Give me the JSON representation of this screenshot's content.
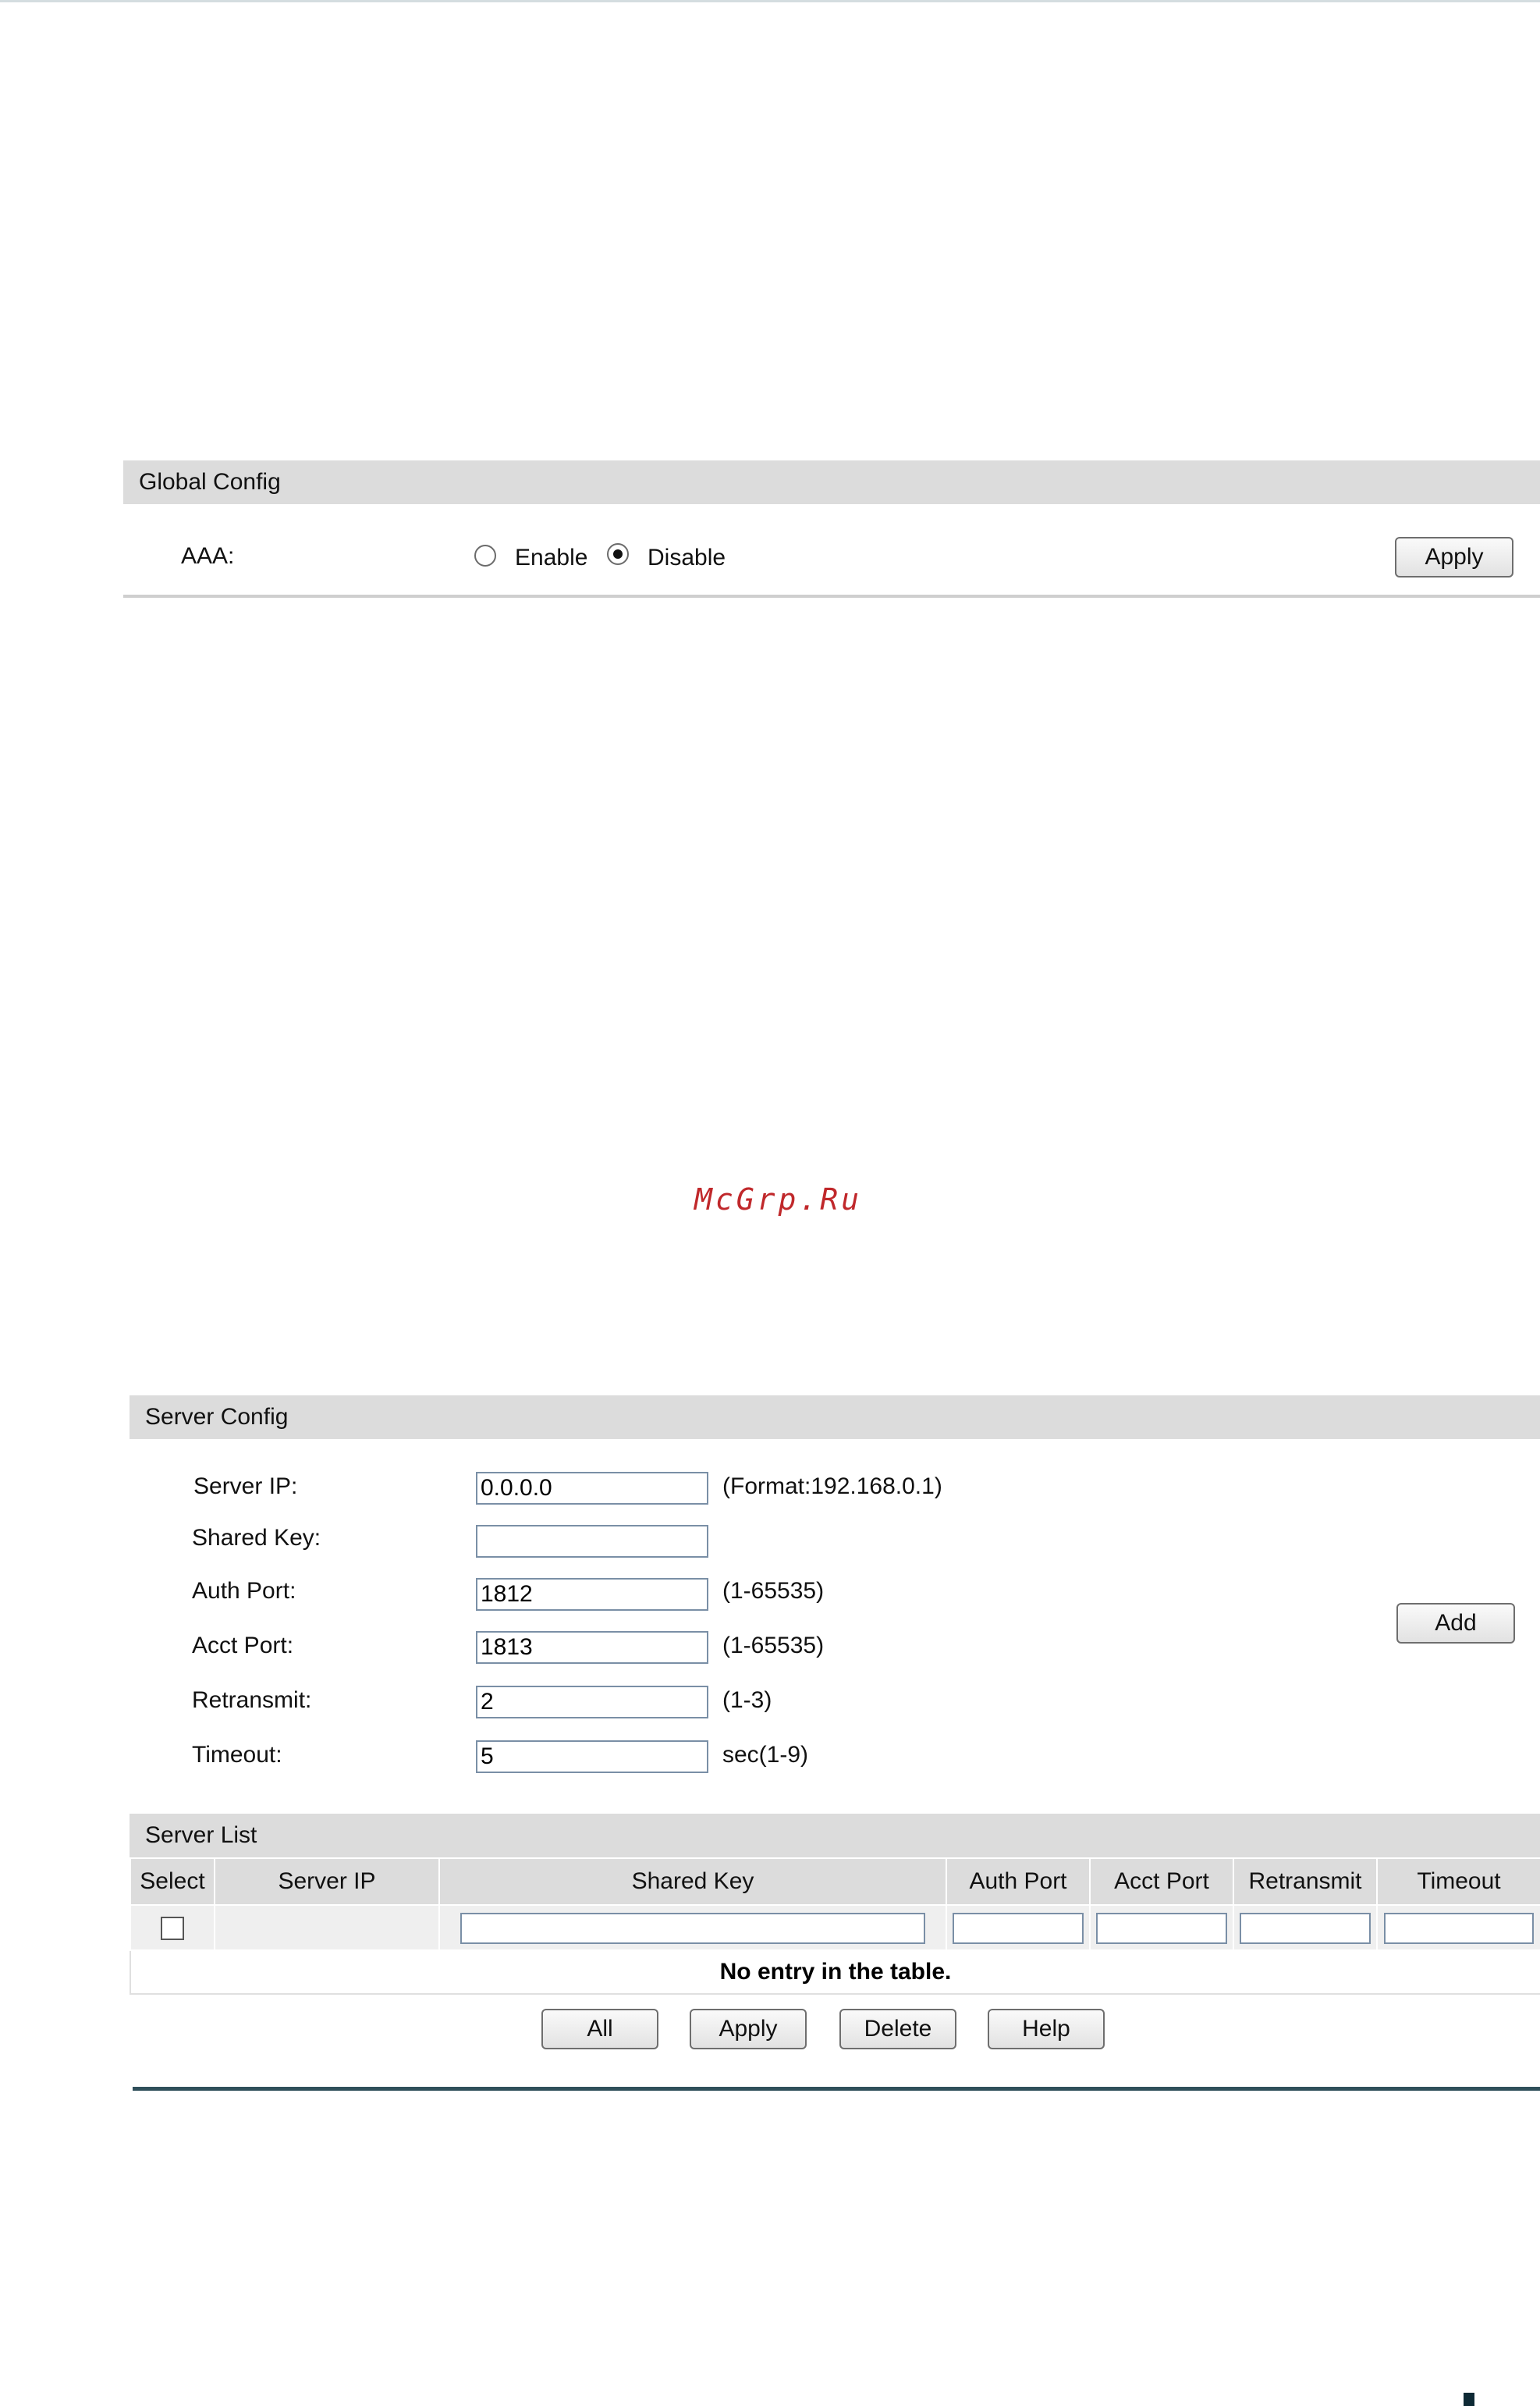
{
  "watermark": "McGrp.Ru",
  "global_config": {
    "title": "Global Config",
    "aaa_label": "AAA:",
    "options": [
      {
        "label": "Enable",
        "selected": false
      },
      {
        "label": "Disable",
        "selected": true
      }
    ],
    "apply_label": "Apply"
  },
  "server_config": {
    "title": "Server Config",
    "server_ip": {
      "label": "Server IP:",
      "value": "0.0.0.0",
      "hint": "(Format:192.168.0.1)"
    },
    "shared_key": {
      "label": "Shared Key:",
      "value": ""
    },
    "auth_port": {
      "label": "Auth Port:",
      "value": "1812",
      "hint": "(1-65535)"
    },
    "acct_port": {
      "label": "Acct Port:",
      "value": "1813",
      "hint": "(1-65535)"
    },
    "retransmit": {
      "label": "Retransmit:",
      "value": "2",
      "hint": "(1-3)"
    },
    "timeout": {
      "label": "Timeout:",
      "value": "5",
      "hint": "sec(1-9)"
    },
    "add_label": "Add"
  },
  "server_list": {
    "title": "Server List",
    "columns": [
      "Select",
      "Server IP",
      "Shared Key",
      "Auth Port",
      "Acct Port",
      "Retransmit",
      "Timeout"
    ],
    "empty_message": "No entry in the table.",
    "buttons": {
      "all": "All",
      "apply": "Apply",
      "delete": "Delete",
      "help": "Help"
    }
  }
}
